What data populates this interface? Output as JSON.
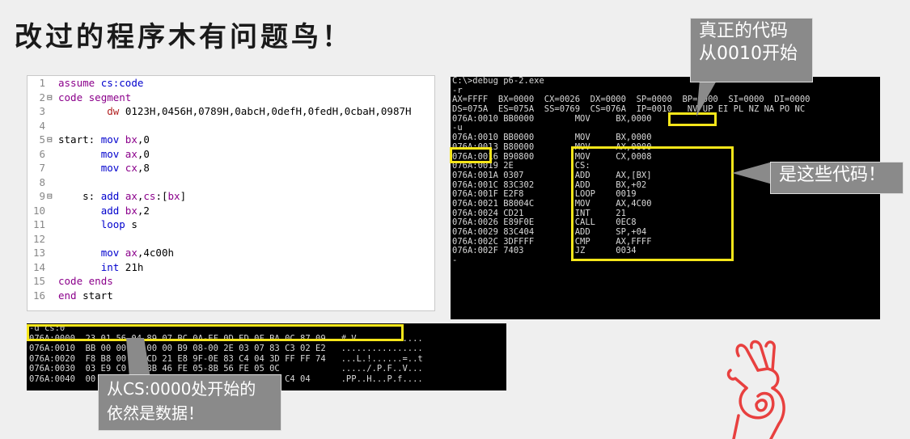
{
  "title": "改过的程序木有问题鸟！",
  "code_lines": [
    {
      "n": "1",
      "fold": "",
      "html": "<span class='kw'>assume</span> <span class='kb'>cs:code</span>"
    },
    {
      "n": "2",
      "fold": "⊟",
      "html": "<span class='kw'>code</span> <span class='kw'>segment</span>"
    },
    {
      "n": "3",
      "fold": "",
      "html": "        <span class='rd'>dw</span> <span class='pl'>0123H,0456H,0789H,0abcH,0defH,0fedH,0cbaH,0987H</span>"
    },
    {
      "n": "4",
      "fold": "",
      "html": ""
    },
    {
      "n": "5",
      "fold": "⊟",
      "html": "<span class='pl'>start:</span> <span class='kb'>mov</span> <span class='kw'>bx</span><span class='pl'>,0</span>"
    },
    {
      "n": "6",
      "fold": "",
      "html": "       <span class='kb'>mov</span> <span class='kw'>ax</span><span class='pl'>,0</span>"
    },
    {
      "n": "7",
      "fold": "",
      "html": "       <span class='kb'>mov</span> <span class='kw'>cx</span><span class='pl'>,8</span>"
    },
    {
      "n": "8",
      "fold": "",
      "html": ""
    },
    {
      "n": "9",
      "fold": "⊟",
      "html": "    <span class='pl'>s:</span> <span class='kb'>add</span> <span class='kw'>ax</span><span class='pl'>,</span><span class='kw'>cs</span><span class='pl'>:[</span><span class='kw'>bx</span><span class='pl'>]</span>"
    },
    {
      "n": "10",
      "fold": "",
      "html": "       <span class='kb'>add</span> <span class='kw'>bx</span><span class='pl'>,2</span>"
    },
    {
      "n": "11",
      "fold": "",
      "html": "       <span class='kb'>loop</span> <span class='pl'>s</span>"
    },
    {
      "n": "12",
      "fold": "",
      "html": ""
    },
    {
      "n": "13",
      "fold": "",
      "html": "       <span class='kb'>mov</span> <span class='kw'>ax</span><span class='pl'>,4c00h</span>"
    },
    {
      "n": "14",
      "fold": "",
      "html": "       <span class='kb'>int</span> <span class='pl'>21h</span>"
    },
    {
      "n": "15",
      "fold": "",
      "html": "<span class='kw'>code</span> <span class='kw'>ends</span>"
    },
    {
      "n": "16",
      "fold": "",
      "html": "<span class='kw'>end</span> <span class='pl'>start</span>"
    }
  ],
  "dos_lines": [
    "C:\\>debug p6-2.exe",
    "-r",
    "AX=FFFF  BX=0000  CX=0026  DX=0000  SP=0000  BP=0000  SI=0000  DI=0000",
    "DS=075A  ES=075A  SS=0769  CS=076A  IP=0010   NV UP EI PL NZ NA PO NC",
    "076A:0010 BB0000        MOV     BX,0000",
    "-u",
    "076A:0010 BB0000        MOV     BX,0000",
    "076A:0013 B80000        MOV     AX,0000",
    "076A:0016 B90800        MOV     CX,0008",
    "076A:0019 2E            CS:",
    "076A:001A 0307          ADD     AX,[BX]",
    "076A:001C 83C302        ADD     BX,+02",
    "076A:001F E2F8          LOOP    0019",
    "076A:0021 B8004C        MOV     AX,4C00",
    "076A:0024 CD21          INT     21",
    "076A:0026 E89F0E        CALL    0EC8",
    "076A:0029 83C404        ADD     SP,+04",
    "076A:002C 3DFFFF        CMP     AX,FFFF",
    "076A:002F 7403          JZ      0034",
    "-"
  ],
  "hex_lines": [
    "-d cs:0",
    "076A:0000  23 01 56 04 89 07 BC 0A-EF 0D ED 0F BA 0C 87 09   #.V.............",
    "076A:0010  BB 00 00 B8 00 00 B9 08-00 2E 03 07 83 C3 02 E2   ................",
    "076A:0020  F8 B8 00 4C CD 21 E8 9F-0E 83 C4 04 3D FF FF 74   ...L.!......=..t",
    "076A:0030  03 E9 C0 00 8B 46 FE 05-8B 56 FE 05 0C            ...../.P.F..V...",
    "076A:0040  00 50 8B 46 FE 05 0E 00-50 8B 7B 0F 83 C4 04      .PP..H...P.f...."
  ],
  "callouts": {
    "real_code": "真正的代码\n从0010开始",
    "these_code": "是这些代码！",
    "still_data": "从CS:0000处开始的\n依然是数据！"
  },
  "colors": {
    "highlight": "#f6e61a",
    "callout_bg": "#8a8a8a",
    "hand": "#e8403f"
  }
}
